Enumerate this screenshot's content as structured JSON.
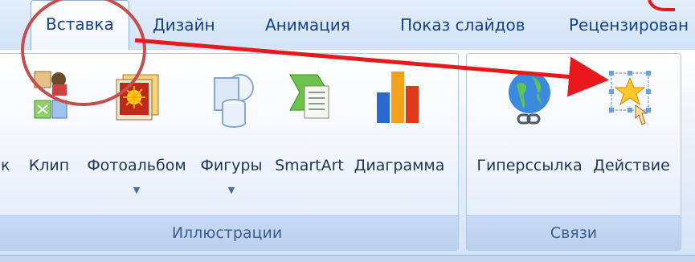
{
  "tabs": [
    {
      "label": "Вставка",
      "active": true
    },
    {
      "label": "Дизайн"
    },
    {
      "label": "Анимация"
    },
    {
      "label": "Показ слайдов"
    },
    {
      "label": "Рецензирован"
    }
  ],
  "groups": {
    "illustrations": {
      "label": "Иллюстрации",
      "partial_label": "к",
      "commands": [
        {
          "label": "Клип",
          "icon": "clip-art-icon"
        },
        {
          "label": "Фотоальбом",
          "icon": "photo-album-icon",
          "dropdown": "▼"
        },
        {
          "label": "Фигуры",
          "icon": "shapes-icon",
          "dropdown": "▼"
        },
        {
          "label": "SmartArt",
          "icon": "smartart-icon"
        },
        {
          "label": "Диаграмма",
          "icon": "chart-icon"
        }
      ]
    },
    "links": {
      "label": "Связи",
      "commands": [
        {
          "label": "Гиперссылка",
          "icon": "hyperlink-globe-icon"
        },
        {
          "label": "Действие",
          "icon": "action-star-icon"
        }
      ]
    }
  },
  "annotation": {
    "circle_color": "#c0504d",
    "arrow_color": "#e8181c"
  },
  "colors": {
    "tab_text": "#15428b",
    "group_label": "#3d5d8c"
  }
}
